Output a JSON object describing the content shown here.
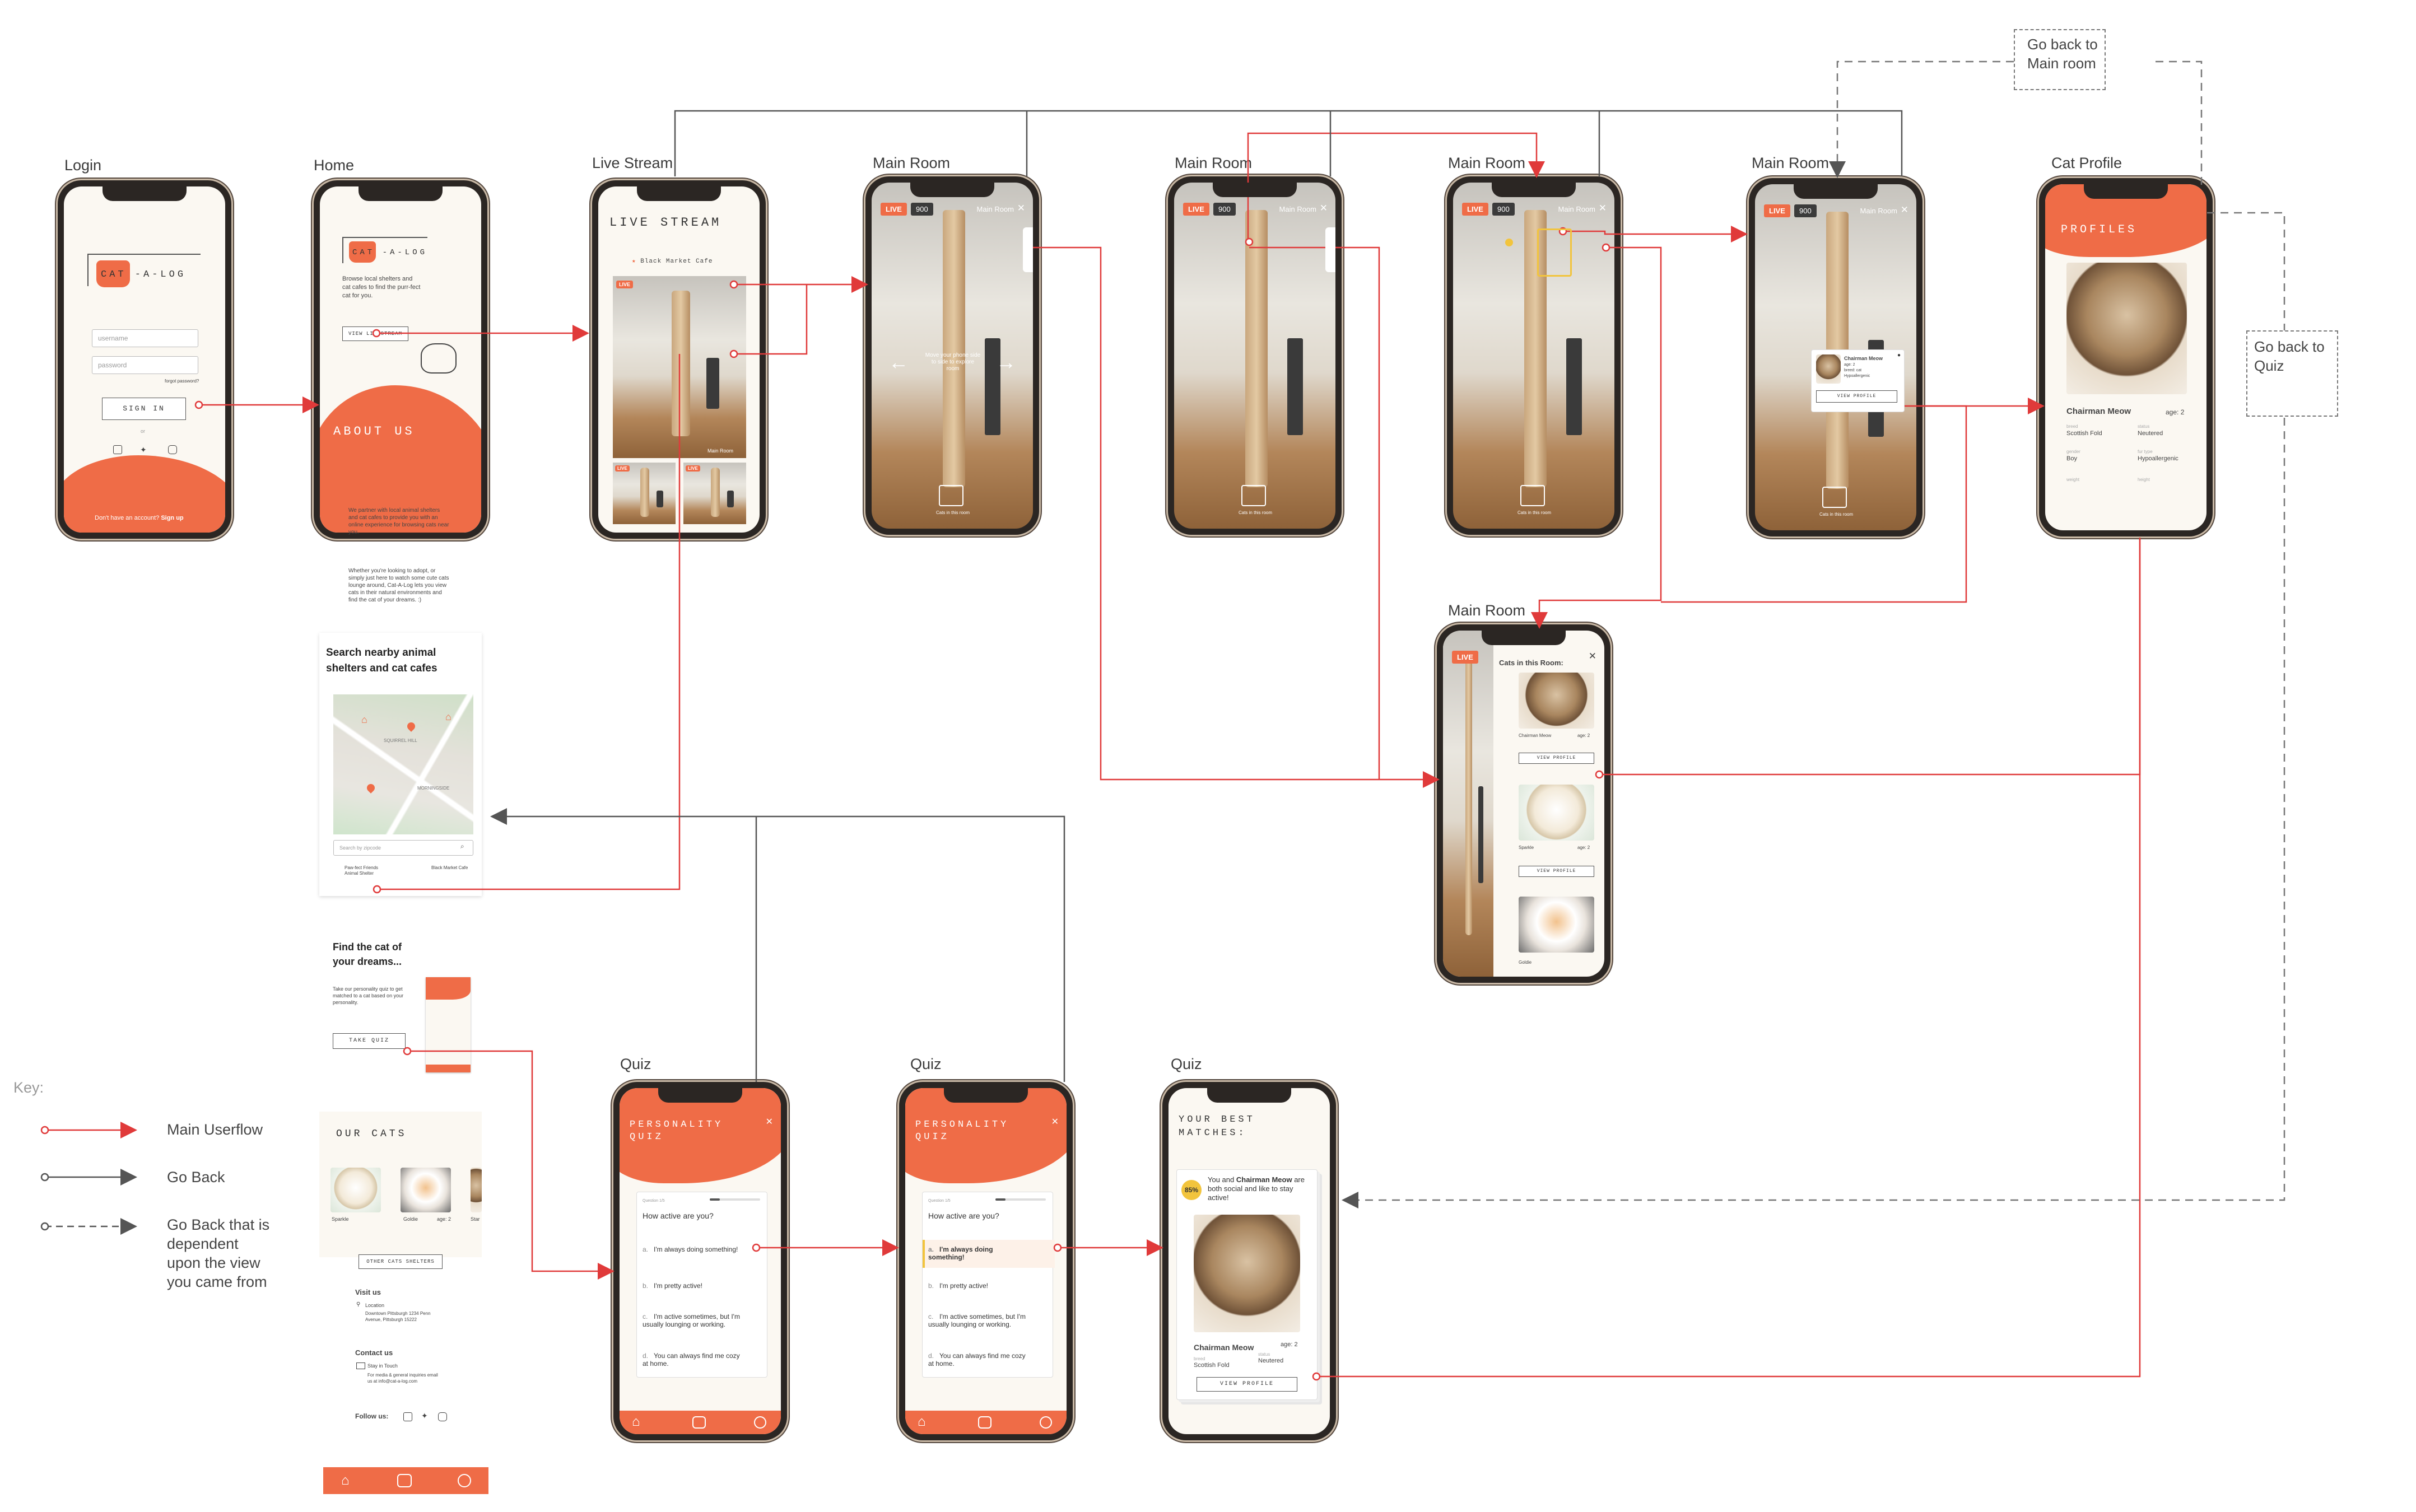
{
  "titles": {
    "login": "Login",
    "home": "Home",
    "live_stream": "Live Stream",
    "main_room_1": "Main Room",
    "main_room_2": "Main Room",
    "main_room_3": "Main Room",
    "main_room_4": "Main Room",
    "main_room_5": "Main Room",
    "cat_profile": "Cat Profile",
    "quiz_1": "Quiz",
    "quiz_2": "Quiz",
    "quiz_3": "Quiz"
  },
  "notes": {
    "go_back_main_room": "Go back to\nMain room",
    "go_back_quiz": "Go back to\nQuiz"
  },
  "legend": {
    "key": "Key:",
    "main_userflow": "Main Userflow",
    "go_back": "Go Back",
    "go_back_dependent": "Go Back that is\ndependent\nupon the view\nyou came from"
  },
  "login": {
    "logo_text": "CAT -A-LOG",
    "username_placeholder": "username",
    "password_placeholder": "password",
    "forgot": "forgot password?",
    "sign_in": "SIGN IN",
    "or": "or",
    "signup_prompt": "Don't have an account?",
    "signup_link": "Sign up"
  },
  "home": {
    "logo_text": "CAT -A-LOG",
    "tagline": "Browse local shelters and cat cafes to find the purr-fect cat for you.",
    "view_livestream": "VIEW LIVESTREAM",
    "about_title": "ABOUT US",
    "about_p1": "We partner with local animal shelters and cat cafes to provide you with an online experience for browsing cats near you.",
    "about_p2": "Whether you're looking to adopt, or simply just here to watch some cute cats lounge around, Cat-A-Log lets you view cats in their natural environments and find the cat of your dreams. :)",
    "search_heading": "Search nearby animal shelters and cat cafes",
    "map_label_1": "SQUIRREL HILL",
    "map_label_2": "MORNINGSIDE",
    "search_placeholder": "Search by zipcode",
    "result_1": "Paw-fect Friends Animal Shelter",
    "result_2": "Black Market Cafe",
    "quiz_heading": "Find the cat of your dreams...",
    "quiz_text": "Take our personality quiz to get matched to a cat based on your personality.",
    "take_quiz": "TAKE QUIZ",
    "our_cats_title": "OUR CATS",
    "cat_1": "Sparkle",
    "cat_2": "Goldie",
    "cat_2_age": "age: 2",
    "cat_3": "Star",
    "other_shelters": "OTHER CATS SHELTERS",
    "visit_us": "Visit us",
    "location": "Location",
    "address": "Downtown Pittsburgh 1234 Penn Avenue, Pittsburgh 15222",
    "contact_us": "Contact us",
    "stay_in_touch": "Stay in Touch",
    "email_text": "For media & general inquiries email us at info@cat-a-log.com",
    "follow_us": "Follow us:"
  },
  "live_stream": {
    "title": "LIVE STREAM",
    "cafe_name": "Black Market Cafe",
    "live_badge": "LIVE",
    "room_label": "Main Room"
  },
  "main_room": {
    "live_badge": "LIVE",
    "views": "900",
    "room_label": "Main Room",
    "swipe_hint": "Move your phone side to side to explore room",
    "cats_hint": "Cats in this room"
  },
  "cat_popup": {
    "name": "Chairman Meow",
    "age": "age: 2",
    "breed": "breed: cat",
    "status": "Hypoallergenic",
    "button": "VIEW PROFILE"
  },
  "cats_in_room": {
    "title": "Cats in this Room:",
    "cats": [
      {
        "name": "Chairman Meow",
        "age": "age: 2",
        "button": "VIEW PROFILE"
      },
      {
        "name": "Sparkle",
        "age": "age: 2",
        "button": "VIEW PROFILE"
      },
      {
        "name": "Goldie",
        "age": "",
        "button": ""
      }
    ]
  },
  "profile": {
    "title": "PROFILES",
    "name": "Chairman Meow",
    "age": "age: 2",
    "breed_label": "breed",
    "breed": "Scottish Fold",
    "status_label": "status",
    "status": "Neutered",
    "gender_label": "gender",
    "gender": "Boy",
    "fur_label": "fur type",
    "fur": "Hypoallergenic",
    "weight_label": "weight",
    "height_label": "height"
  },
  "quiz": {
    "title": "PERSONALITY QUIZ",
    "progress": "Question 1/5",
    "question": "How active are you?",
    "options": [
      {
        "letter": "a.",
        "text": "I'm always doing something!"
      },
      {
        "letter": "b.",
        "text": "I'm pretty active!"
      },
      {
        "letter": "c.",
        "text": "I'm active sometimes, but I'm usually lounging or working."
      },
      {
        "letter": "d.",
        "text": "You can always find me cozy at home."
      }
    ]
  },
  "match": {
    "title": "YOUR BEST MATCHES:",
    "percent": "85%",
    "text_pre": "You and",
    "name_inline": "Chairman Meow",
    "text_post": "are both social and like to stay active!",
    "name": "Chairman Meow",
    "age": "age: 2",
    "breed_label": "breed",
    "breed": "Scottish Fold",
    "status_label": "status",
    "status": "Neutered",
    "button": "VIEW PROFILE"
  },
  "colors": {
    "accent": "#ef6c47",
    "flow_main": "#e03a3a",
    "flow_back": "#555555"
  }
}
